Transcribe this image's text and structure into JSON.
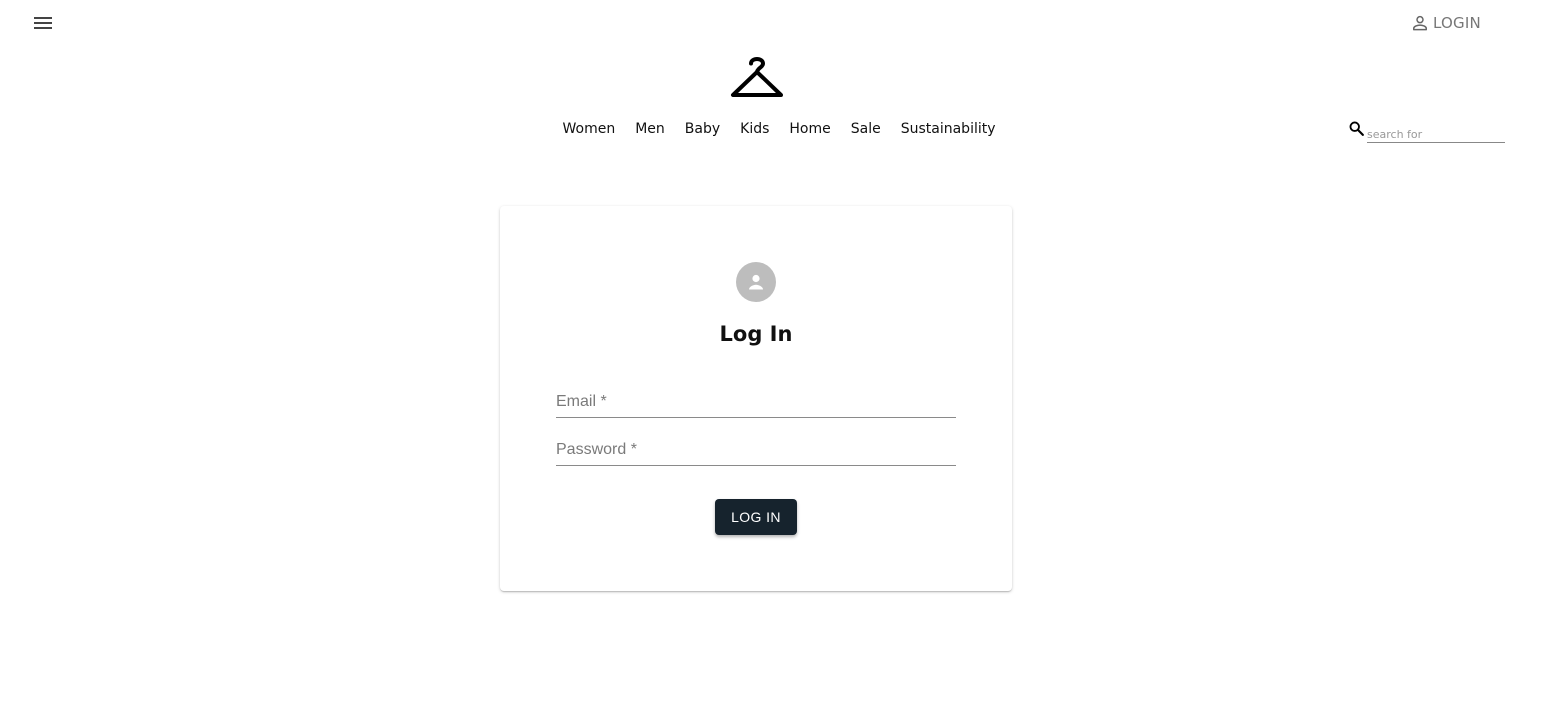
{
  "header": {
    "menu_icon": "hamburger-menu-icon",
    "login_icon": "person-outline-icon",
    "login_label": "LOGIN",
    "logo_icon": "clothes-hanger-icon"
  },
  "nav": {
    "items": [
      "Women",
      "Men",
      "Baby",
      "Kids",
      "Home",
      "Sale",
      "Sustainability"
    ]
  },
  "search": {
    "icon": "search-icon",
    "placeholder": "search for",
    "value": ""
  },
  "login_form": {
    "avatar_icon": "account-circle-icon",
    "title": "Log In",
    "email_label": "Email *",
    "password_label": "Password *",
    "submit_label": "LOG IN",
    "button_color": "#16232d"
  }
}
